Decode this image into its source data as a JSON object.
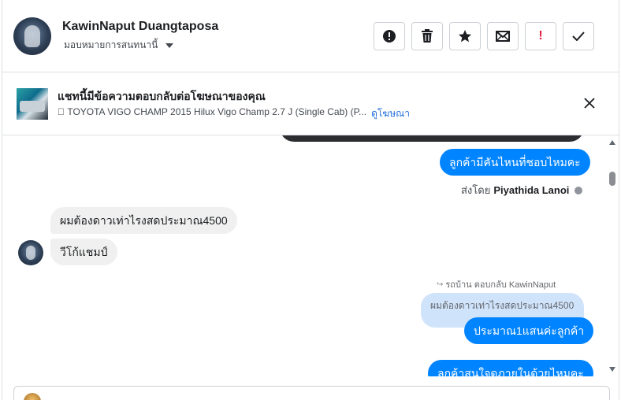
{
  "header": {
    "user_name": "KawinNaput Duangtaposa",
    "assign_label": "มอบหมายการสนทนานี้",
    "actions": [
      {
        "name": "mark-spam-button",
        "icon": "alert-circle-icon"
      },
      {
        "name": "delete-button",
        "icon": "trash-icon"
      },
      {
        "name": "star-button",
        "icon": "star-icon"
      },
      {
        "name": "mark-unread-button",
        "icon": "envelope-icon"
      },
      {
        "name": "follow-up-button",
        "icon": "exclamation-icon",
        "color": "#e41e3f"
      },
      {
        "name": "mark-done-button",
        "icon": "check-icon"
      }
    ],
    "follow_up_text": "!"
  },
  "ad_banner": {
    "title": "แชทนี้มีข้อความตอบกลับต่อโฆษณาของคุณ",
    "subtitle": "􀀀 TOYOTA VIGO CHAMP 2015 Hilux Vigo Champ 2.7 J (Single Cab) (P...",
    "link_label": "ดูโฆษณา",
    "link_color": "#216fdb"
  },
  "messages": {
    "out_1": "ลูกค้ามีคันไหนที่ชอบไหมคะ",
    "sent_by_prefix": "ส่งโดย",
    "sent_by_name": "Piyathida Lanoi",
    "in_1": "ผมต้องดาวเท่าไรงสดประมาณ4500",
    "in_2": "วีโก้แชมป์",
    "reply_meta": "รถบ้าน ตอบกลับ KawinNaput",
    "quoted_text": "ผมต้องดาวเท่าไรงสดประมาณ4500",
    "out_2": "ประมาณ1แสนค่ะลูกค้า",
    "out_3": "ลูกค้าสนใจดูภายในด้วยไหมคะ"
  },
  "colors": {
    "outgoing_bubble": "#0084ff",
    "incoming_bubble": "#f0f0f0",
    "quoted_bubble": "#cfe3fb"
  },
  "composer": {
    "placeholder": ""
  }
}
